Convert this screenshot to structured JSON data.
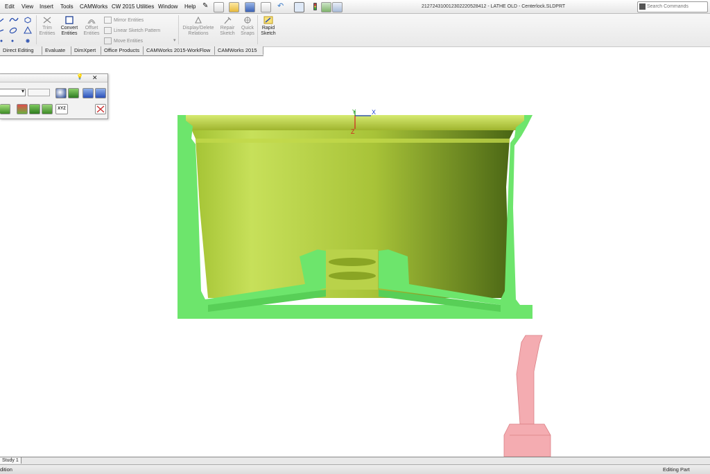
{
  "menu": {
    "items": [
      "Edit",
      "View",
      "Insert",
      "Tools",
      "CAMWorks",
      "CW 2015 Utilities",
      "Window",
      "Help"
    ]
  },
  "document": {
    "title": "21272431001230222052​8412 - LATHE OLD - Centerlock.SLDPRT"
  },
  "search": {
    "placeholder": "Search Commands"
  },
  "ribbon": {
    "trim": "Trim Entities",
    "convert": "Convert Entities",
    "offset": "Offset Entities",
    "mirror": "Mirror Entities",
    "linear_pattern": "Linear Sketch Pattern",
    "move": "Move Entities",
    "display_relations": "Display/Delete Relations",
    "repair": "Repair Sketch",
    "quick_snaps": "Quick Snaps",
    "rapid_sketch": "Rapid Sketch"
  },
  "tabs": [
    "Direct Editing",
    "Evaluate",
    "DimXpert",
    "Office Products",
    "CAMWorks 2015-WorkFlow",
    "CAMWorks 2015"
  ],
  "floating_toolbar": {
    "xyz_label": "XYZ"
  },
  "triad": {
    "x": "X",
    "y": "Y",
    "z": "Z"
  },
  "bottom": {
    "study_tab": "Study 1"
  },
  "status": {
    "left": "dition",
    "right": "Editing Part"
  },
  "colors": {
    "part": "#a8c83a",
    "section": "#6ee36e",
    "tool": "#f29aa0",
    "accent": "#2255c4"
  }
}
